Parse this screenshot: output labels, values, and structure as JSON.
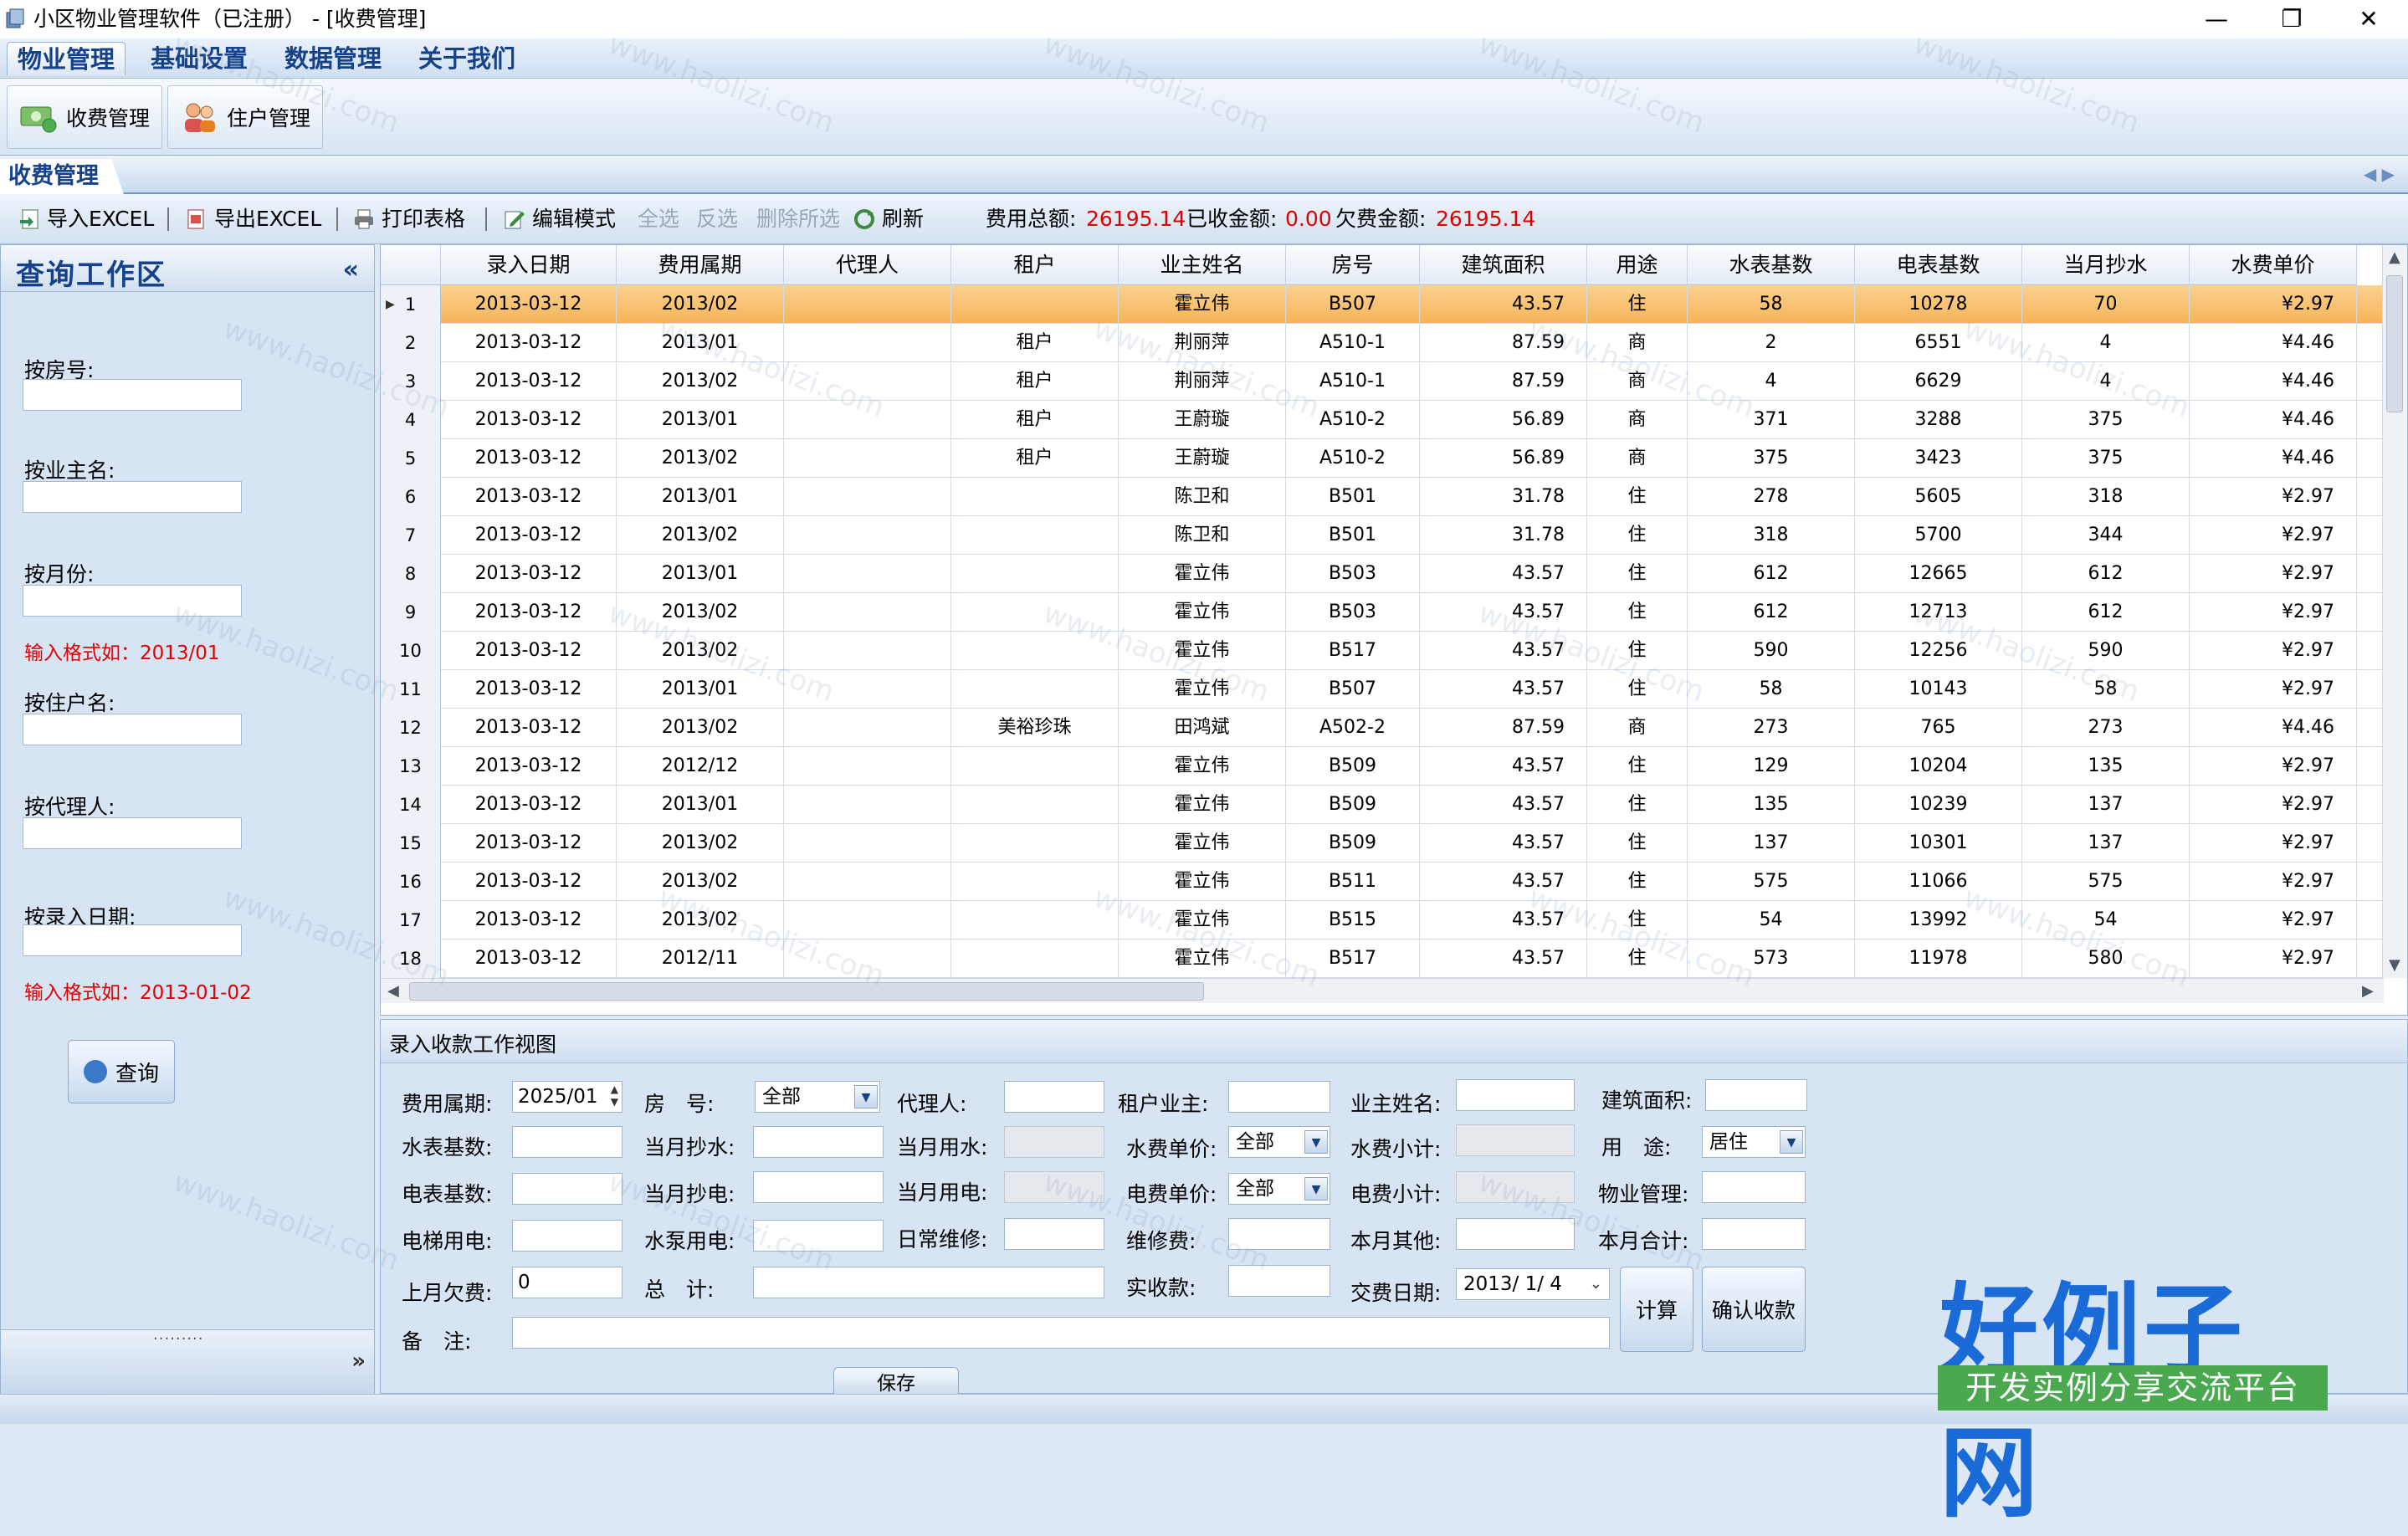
{
  "window": {
    "title": "小区物业管理软件（已注册） - [收费管理]",
    "minimize": "—",
    "restore": "❐",
    "close": "✕"
  },
  "menu": [
    "物业管理",
    "基础设置",
    "数据管理",
    "关于我们"
  ],
  "ribbon": {
    "fee_mgmt": "收费管理",
    "resident_mgmt": "住户管理"
  },
  "doc_tab": "收费管理",
  "toolbar": {
    "import_excel": "导入EXCEL",
    "export_excel": "导出EXCEL",
    "print_table": "打印表格",
    "edit_mode": "编辑模式",
    "select_all": "全选",
    "invert_select": "反选",
    "delete_selected": "删除所选",
    "refresh": "刷新",
    "total_label": "费用总额:",
    "total_value": "26195.14",
    "received_label": "已收金额:",
    "received_value": "0.00",
    "owed_label": "欠费金额:",
    "owed_value": "26195.14"
  },
  "query_panel": {
    "title": "查询工作区",
    "collapse": "«",
    "by_room": "按房号:",
    "by_owner": "按业主名:",
    "by_month": "按月份:",
    "month_hint": "输入格式如：2013/01",
    "by_resident": "按住户名:",
    "by_agent": "按代理人:",
    "by_entry_date": "按录入日期:",
    "date_hint": "输入格式如：2013-01-02",
    "query_button": "查询",
    "splitter_dots": "·········",
    "expand": "»"
  },
  "grid": {
    "columns": [
      "录入日期",
      "费用属期",
      "代理人",
      "租户",
      "业主姓名",
      "房号",
      "建筑面积",
      "用途",
      "水表基数",
      "电表基数",
      "当月抄水",
      "水费单价"
    ],
    "rows": [
      [
        "1",
        "2013-03-12",
        "2013/02",
        "",
        "",
        "霍立伟",
        "B507",
        "43.57",
        "住",
        "58",
        "10278",
        "70",
        "¥2.97"
      ],
      [
        "2",
        "2013-03-12",
        "2013/01",
        "",
        "租户",
        "荆丽萍",
        "A510-1",
        "87.59",
        "商",
        "2",
        "6551",
        "4",
        "¥4.46"
      ],
      [
        "3",
        "2013-03-12",
        "2013/02",
        "",
        "租户",
        "荆丽萍",
        "A510-1",
        "87.59",
        "商",
        "4",
        "6629",
        "4",
        "¥4.46"
      ],
      [
        "4",
        "2013-03-12",
        "2013/01",
        "",
        "租户",
        "王蔚璇",
        "A510-2",
        "56.89",
        "商",
        "371",
        "3288",
        "375",
        "¥4.46"
      ],
      [
        "5",
        "2013-03-12",
        "2013/02",
        "",
        "租户",
        "王蔚璇",
        "A510-2",
        "56.89",
        "商",
        "375",
        "3423",
        "375",
        "¥4.46"
      ],
      [
        "6",
        "2013-03-12",
        "2013/01",
        "",
        "",
        "陈卫和",
        "B501",
        "31.78",
        "住",
        "278",
        "5605",
        "318",
        "¥2.97"
      ],
      [
        "7",
        "2013-03-12",
        "2013/02",
        "",
        "",
        "陈卫和",
        "B501",
        "31.78",
        "住",
        "318",
        "5700",
        "344",
        "¥2.97"
      ],
      [
        "8",
        "2013-03-12",
        "2013/01",
        "",
        "",
        "霍立伟",
        "B503",
        "43.57",
        "住",
        "612",
        "12665",
        "612",
        "¥2.97"
      ],
      [
        "9",
        "2013-03-12",
        "2013/02",
        "",
        "",
        "霍立伟",
        "B503",
        "43.57",
        "住",
        "612",
        "12713",
        "612",
        "¥2.97"
      ],
      [
        "10",
        "2013-03-12",
        "2013/02",
        "",
        "",
        "霍立伟",
        "B517",
        "43.57",
        "住",
        "590",
        "12256",
        "590",
        "¥2.97"
      ],
      [
        "11",
        "2013-03-12",
        "2013/01",
        "",
        "",
        "霍立伟",
        "B507",
        "43.57",
        "住",
        "58",
        "10143",
        "58",
        "¥2.97"
      ],
      [
        "12",
        "2013-03-12",
        "2013/02",
        "",
        "美裕珍珠",
        "田鸿斌",
        "A502-2",
        "87.59",
        "商",
        "273",
        "765",
        "273",
        "¥4.46"
      ],
      [
        "13",
        "2013-03-12",
        "2012/12",
        "",
        "",
        "霍立伟",
        "B509",
        "43.57",
        "住",
        "129",
        "10204",
        "135",
        "¥2.97"
      ],
      [
        "14",
        "2013-03-12",
        "2013/01",
        "",
        "",
        "霍立伟",
        "B509",
        "43.57",
        "住",
        "135",
        "10239",
        "137",
        "¥2.97"
      ],
      [
        "15",
        "2013-03-12",
        "2013/02",
        "",
        "",
        "霍立伟",
        "B509",
        "43.57",
        "住",
        "137",
        "10301",
        "137",
        "¥2.97"
      ],
      [
        "16",
        "2013-03-12",
        "2013/02",
        "",
        "",
        "霍立伟",
        "B511",
        "43.57",
        "住",
        "575",
        "11066",
        "575",
        "¥2.97"
      ],
      [
        "17",
        "2013-03-12",
        "2013/02",
        "",
        "",
        "霍立伟",
        "B515",
        "43.57",
        "住",
        "54",
        "13992",
        "54",
        "¥2.97"
      ],
      [
        "18",
        "2013-03-12",
        "2012/11",
        "",
        "",
        "霍立伟",
        "B517",
        "43.57",
        "住",
        "573",
        "11978",
        "580",
        "¥2.97"
      ]
    ],
    "selected_row": 0
  },
  "form": {
    "title": "录入收款工作视图",
    "fee_period_label": "费用属期:",
    "fee_period_value": "2025/01",
    "room_label": "房　号:",
    "room_value": "全部",
    "agent_label": "代理人:",
    "tenant_owner_label": "租户业主:",
    "owner_name_label": "业主姓名:",
    "area_label": "建筑面积:",
    "water_base_label": "水表基数:",
    "water_read_label": "当月抄水:",
    "water_used_label": "当月用水:",
    "water_price_label": "水费单价:",
    "water_price_value": "全部",
    "water_subtotal_label": "水费小计:",
    "usage_label": "用　途:",
    "usage_value": "居住",
    "elec_base_label": "电表基数:",
    "elec_read_label": "当月抄电:",
    "elec_used_label": "当月用电:",
    "elec_price_label": "电费单价:",
    "elec_price_value": "全部",
    "elec_subtotal_label": "电费小计:",
    "property_mgmt_label": "物业管理:",
    "elevator_label": "电梯用电:",
    "pump_label": "水泵用电:",
    "maintenance_label": "日常维修:",
    "repair_fee_label": "维修费:",
    "other_label": "本月其他:",
    "month_total_label": "本月合计:",
    "last_owed_label": "上月欠费:",
    "last_owed_value": "0",
    "total_label": "总　计:",
    "received_label": "实收款:",
    "pay_date_label": "交费日期:",
    "pay_date_value": "2013/ 1/ 4",
    "calc_button": "计算",
    "confirm_button": "确认收款",
    "remark_label": "备　注:",
    "save_tab": "保存"
  },
  "watermark": {
    "text": "www.haolizi.com",
    "logo": "好例子网",
    "logo_sub": "开发实例分享交流平台"
  },
  "colors": {
    "accent": "#15428b",
    "selected_row": "#f5b45a",
    "money_red": "#e00000",
    "logo_blue": "#1a6ad8",
    "logo_green": "#4aa84f"
  }
}
